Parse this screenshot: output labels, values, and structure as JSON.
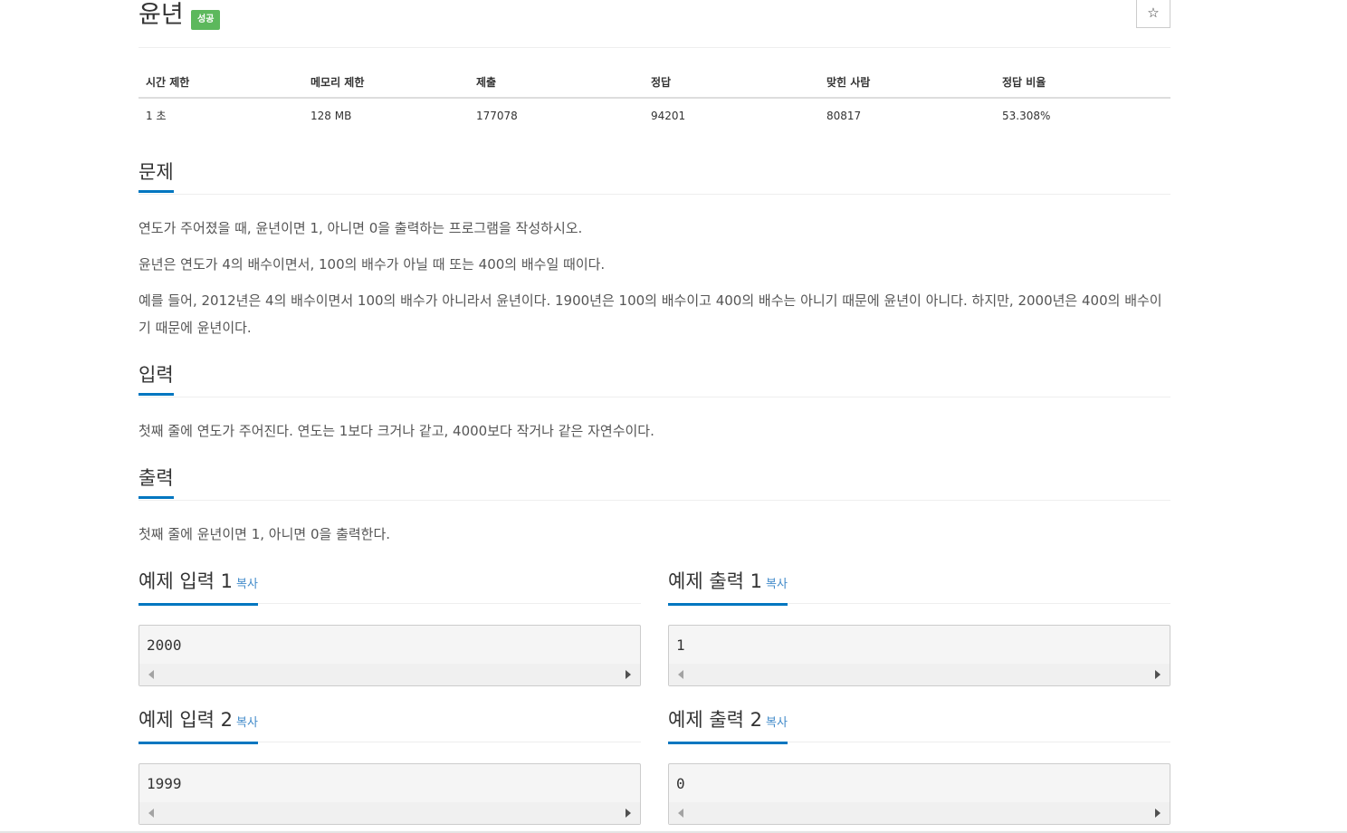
{
  "problem": {
    "title": "윤년",
    "status_badge": "성공",
    "star_icon": "☆"
  },
  "info_table": {
    "headers": [
      "시간 제한",
      "메모리 제한",
      "제출",
      "정답",
      "맞힌 사람",
      "정답 비율"
    ],
    "values": [
      "1 초",
      "128 MB",
      "177078",
      "94201",
      "80817",
      "53.308%"
    ]
  },
  "sections": {
    "problem_heading": "문제",
    "problem_paragraphs": [
      "연도가 주어졌을 때, 윤년이면 1, 아니면 0을 출력하는 프로그램을 작성하시오.",
      "윤년은 연도가 4의 배수이면서, 100의 배수가 아닐 때 또는 400의 배수일 때이다.",
      "예를 들어, 2012년은 4의 배수이면서 100의 배수가 아니라서 윤년이다. 1900년은 100의 배수이고 400의 배수는 아니기 때문에 윤년이 아니다. 하지만, 2000년은 400의 배수이기 때문에 윤년이다."
    ],
    "input_heading": "입력",
    "input_text": "첫째 줄에 연도가 주어진다. 연도는 1보다 크거나 같고, 4000보다 작거나 같은 자연수이다.",
    "output_heading": "출력",
    "output_text": "첫째 줄에 윤년이면 1, 아니면 0을 출력한다."
  },
  "samples": {
    "copy_label": "복사",
    "input1_heading": "예제 입력 1",
    "output1_heading": "예제 출력 1",
    "input2_heading": "예제 입력 2",
    "output2_heading": "예제 출력 2",
    "input1": "2000",
    "output1": "1",
    "input2": "1999",
    "output2": "0"
  }
}
